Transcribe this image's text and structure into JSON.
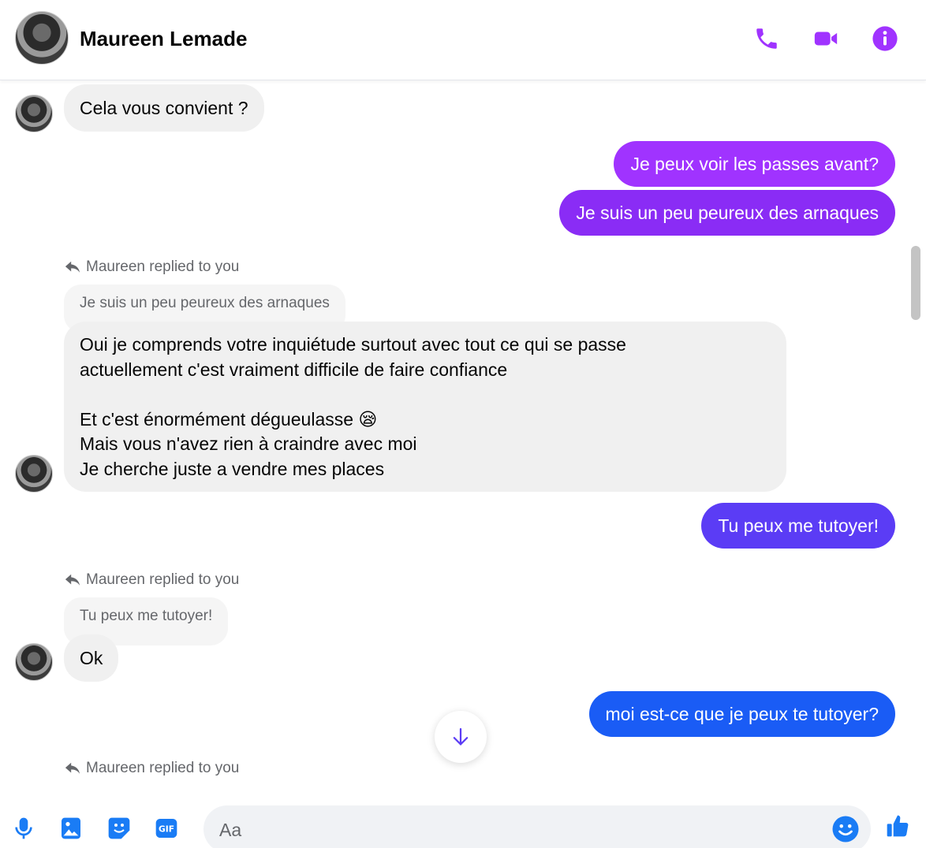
{
  "header": {
    "contact_name": "Maureen Lemade",
    "icons": [
      "phone-icon",
      "video-camera-icon",
      "info-icon"
    ],
    "accent_color": "#a033ff"
  },
  "messages": {
    "m1": "Cela vous convient ?",
    "m2": "Je peux voir les passes avant?",
    "m3": "Je suis un peu peureux des arnaques",
    "reply1_label": "Maureen replied to you",
    "reply1_quote": "Je suis un peu peureux des arnaques",
    "m4": "Oui je comprends votre inquiétude surtout avec tout ce qui se passe\nactuellement c'est vraiment difficile de faire confiance\n\nEt c'est énormément dégueulasse 😪\nMais vous n'avez rien à craindre avec moi\nJe cherche juste a vendre mes places",
    "m5": "Tu peux me tutoyer!",
    "reply2_label": "Maureen replied to you",
    "reply2_quote": "Tu peux me tutoyer!",
    "m6": "Ok",
    "m7": "moi est-ce que je peux te tutoyer?",
    "reply3_label": "Maureen replied to you"
  },
  "colors": {
    "outgoing_purple": "#a033ff",
    "outgoing_violet": "#8a2cf5",
    "outgoing_indigo": "#5b3cf5",
    "outgoing_blue": "#1a5cf5",
    "incoming_bg": "#f0f0f0"
  },
  "composer": {
    "placeholder": "Aa",
    "icons": [
      "microphone-icon",
      "image-icon",
      "sticker-icon",
      "gif-icon",
      "emoji-icon",
      "thumbs-up-icon"
    ]
  }
}
